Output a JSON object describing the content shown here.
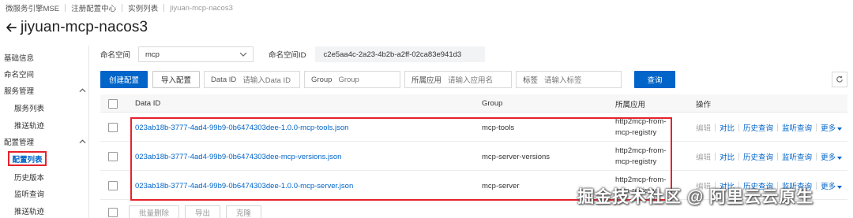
{
  "breadcrumb": [
    "微服务引擎MSE",
    "注册配置中心",
    "实例列表",
    "jiyuan-mcp-nacos3"
  ],
  "page_title": "jiyuan-mcp-nacos3",
  "sidebar": {
    "items": [
      {
        "label": "基础信息"
      },
      {
        "label": "命名空间"
      },
      {
        "label": "服务管理"
      },
      {
        "label": "服务列表"
      },
      {
        "label": "推送轨迹"
      },
      {
        "label": "配置管理"
      },
      {
        "label": "配置列表"
      },
      {
        "label": "历史版本"
      },
      {
        "label": "监听查询"
      },
      {
        "label": "推送轨迹"
      }
    ]
  },
  "filters": {
    "namespace_label": "命名空间",
    "namespace_value": "mcp",
    "namespace_id_label": "命名空间ID",
    "namespace_id_value": "c2e5aa4c-2a23-4b2b-a2ff-02ca83e941d3"
  },
  "toolbar": {
    "create_label": "创建配置",
    "import_label": "导入配置",
    "dataid_label": "Data ID",
    "dataid_placeholder": "请输入Data ID",
    "group_label": "Group",
    "group_placeholder": "Group",
    "app_label": "所属应用",
    "app_placeholder": "请输入应用名",
    "tag_label": "标签",
    "tag_placeholder": "请输入标签",
    "query_label": "查询"
  },
  "table": {
    "headers": {
      "dataid": "Data ID",
      "group": "Group",
      "app": "所属应用",
      "ops": "操作"
    },
    "rows": [
      {
        "dataid": "023ab18b-3777-4ad4-99b9-0b6474303dee-1.0.0-mcp-tools.json",
        "group": "mcp-tools",
        "app": "http2mcp-from-mcp-registry"
      },
      {
        "dataid": "023ab18b-3777-4ad4-99b9-0b6474303dee-mcp-versions.json",
        "group": "mcp-server-versions",
        "app": "http2mcp-from-mcp-registry"
      },
      {
        "dataid": "023ab18b-3777-4ad4-99b9-0b6474303dee-1.0.0-mcp-server.json",
        "group": "mcp-server",
        "app": "http2mcp-from-mcp-registry"
      }
    ],
    "ops": {
      "edit": "编辑",
      "compare": "对比",
      "history": "历史查询",
      "listen": "监听查询",
      "more": "更多"
    }
  },
  "bottom_actions": {
    "batch_delete": "批量删除",
    "export": "导出",
    "clone": "克隆"
  },
  "watermark": "掘金技术社区 @ 阿里云云原生",
  "colors": {
    "accent": "#0064c8",
    "highlight": "#e6222c"
  }
}
